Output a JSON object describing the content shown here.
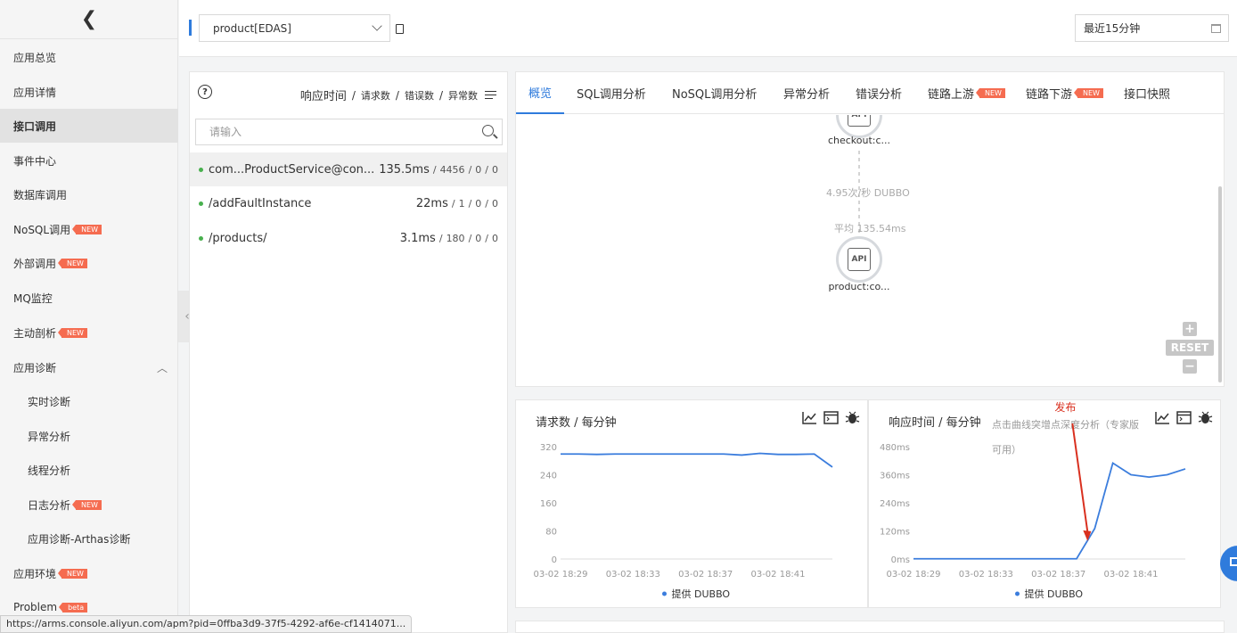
{
  "sidebar": {
    "back_icon": "chevron-left-icon",
    "items": [
      {
        "label": "应用总览"
      },
      {
        "label": "应用详情"
      },
      {
        "label": "接口调用",
        "active": true
      },
      {
        "label": "事件中心"
      },
      {
        "label": "数据库调用"
      },
      {
        "label": "NoSQL调用",
        "badge": "NEW"
      },
      {
        "label": "外部调用",
        "badge": "NEW"
      },
      {
        "label": "MQ监控"
      },
      {
        "label": "主动剖析",
        "badge": "NEW"
      },
      {
        "label": "应用诊断",
        "expanded": true
      },
      {
        "label": "实时诊断"
      },
      {
        "label": "异常分析"
      },
      {
        "label": "线程分析"
      },
      {
        "label": "日志分析",
        "badge": "NEW"
      },
      {
        "label": "应用诊断-Arthas诊断"
      },
      {
        "label": "应用环境",
        "badge": "NEW"
      },
      {
        "label": "Problem",
        "badge": "beta"
      }
    ]
  },
  "topbar": {
    "app_select": "product[EDAS]",
    "time_range": "最近15分钟"
  },
  "list": {
    "sort": {
      "rt": "响应时间",
      "req": "请求数",
      "err": "错误数",
      "exc": "异常数",
      "sep": "/"
    },
    "search_placeholder": "请输入",
    "rows": [
      {
        "name": "com...ProductService@con...",
        "rt": "135.5ms",
        "req": "4456",
        "err": "0",
        "exc": "0"
      },
      {
        "name": "/addFaultInstance",
        "rt": "22ms",
        "req": "1",
        "err": "0",
        "exc": "0"
      },
      {
        "name": "/products/",
        "rt": "3.1ms",
        "req": "180",
        "err": "0",
        "exc": "0"
      }
    ]
  },
  "tabs": [
    {
      "label": "概览",
      "active": true
    },
    {
      "label": "SQL调用分析"
    },
    {
      "label": "NoSQL调用分析"
    },
    {
      "label": "异常分析"
    },
    {
      "label": "错误分析"
    },
    {
      "label": "链路上游",
      "badge": "NEW"
    },
    {
      "label": "链路下游",
      "badge": "NEW"
    },
    {
      "label": "接口快照"
    }
  ],
  "topology": {
    "upstream_label": "checkout:c...",
    "edge_rate": "4.95次/秒 DUBBO",
    "edge_avg": "平均 135.54ms",
    "downstream_label": "product:co...",
    "node_icon_text": "API",
    "reset_label": "RESET"
  },
  "charts": {
    "requests": {
      "title": "请求数 / 每分钟",
      "legend": "提供 DUBBO"
    },
    "response": {
      "title": "响应时间 / 每分钟",
      "subtitle": "点击曲线突增点深度分析（专家版可用）",
      "legend": "提供 DUBBO",
      "annotation": "发布"
    },
    "line_color": "#3b7ddd",
    "annotation_color": "#d9301f"
  },
  "chart_data": [
    {
      "type": "line",
      "title": "请求数 / 每分钟",
      "x_ticks": [
        "03-02 18:29",
        "03-02 18:33",
        "03-02 18:37",
        "03-02 18:41"
      ],
      "y_ticks": [
        "0",
        "80",
        "160",
        "240",
        "320"
      ],
      "ylim": [
        0,
        320
      ],
      "x": [
        0,
        1,
        2,
        3,
        4,
        5,
        6,
        7,
        8,
        9,
        10,
        11,
        12,
        13,
        14,
        15
      ],
      "series": [
        {
          "name": "提供 DUBBO",
          "values": [
            299,
            299,
            298,
            299,
            299,
            299,
            299,
            299,
            299,
            299,
            296,
            301,
            298,
            298,
            299,
            262
          ]
        }
      ],
      "legend_position": "bottom"
    },
    {
      "type": "line",
      "title": "响应时间 / 每分钟",
      "x_ticks": [
        "03-02 18:29",
        "03-02 18:33",
        "03-02 18:37",
        "03-02 18:41"
      ],
      "y_ticks": [
        "0ms",
        "120ms",
        "240ms",
        "360ms",
        "480ms"
      ],
      "ylim": [
        0,
        480
      ],
      "x": [
        0,
        1,
        2,
        3,
        4,
        5,
        6,
        7,
        8,
        9,
        10,
        11,
        12,
        13,
        14,
        15
      ],
      "series": [
        {
          "name": "提供 DUBBO",
          "values": [
            1,
            1,
            1,
            1,
            1,
            1,
            1,
            1,
            1,
            1,
            130,
            410,
            360,
            350,
            360,
            385
          ]
        }
      ],
      "legend_position": "bottom"
    }
  ],
  "status_url": "https://arms.console.aliyun.com/apm?pid=0ffba3d9-37f5-4292-af6e-cf1414071..."
}
